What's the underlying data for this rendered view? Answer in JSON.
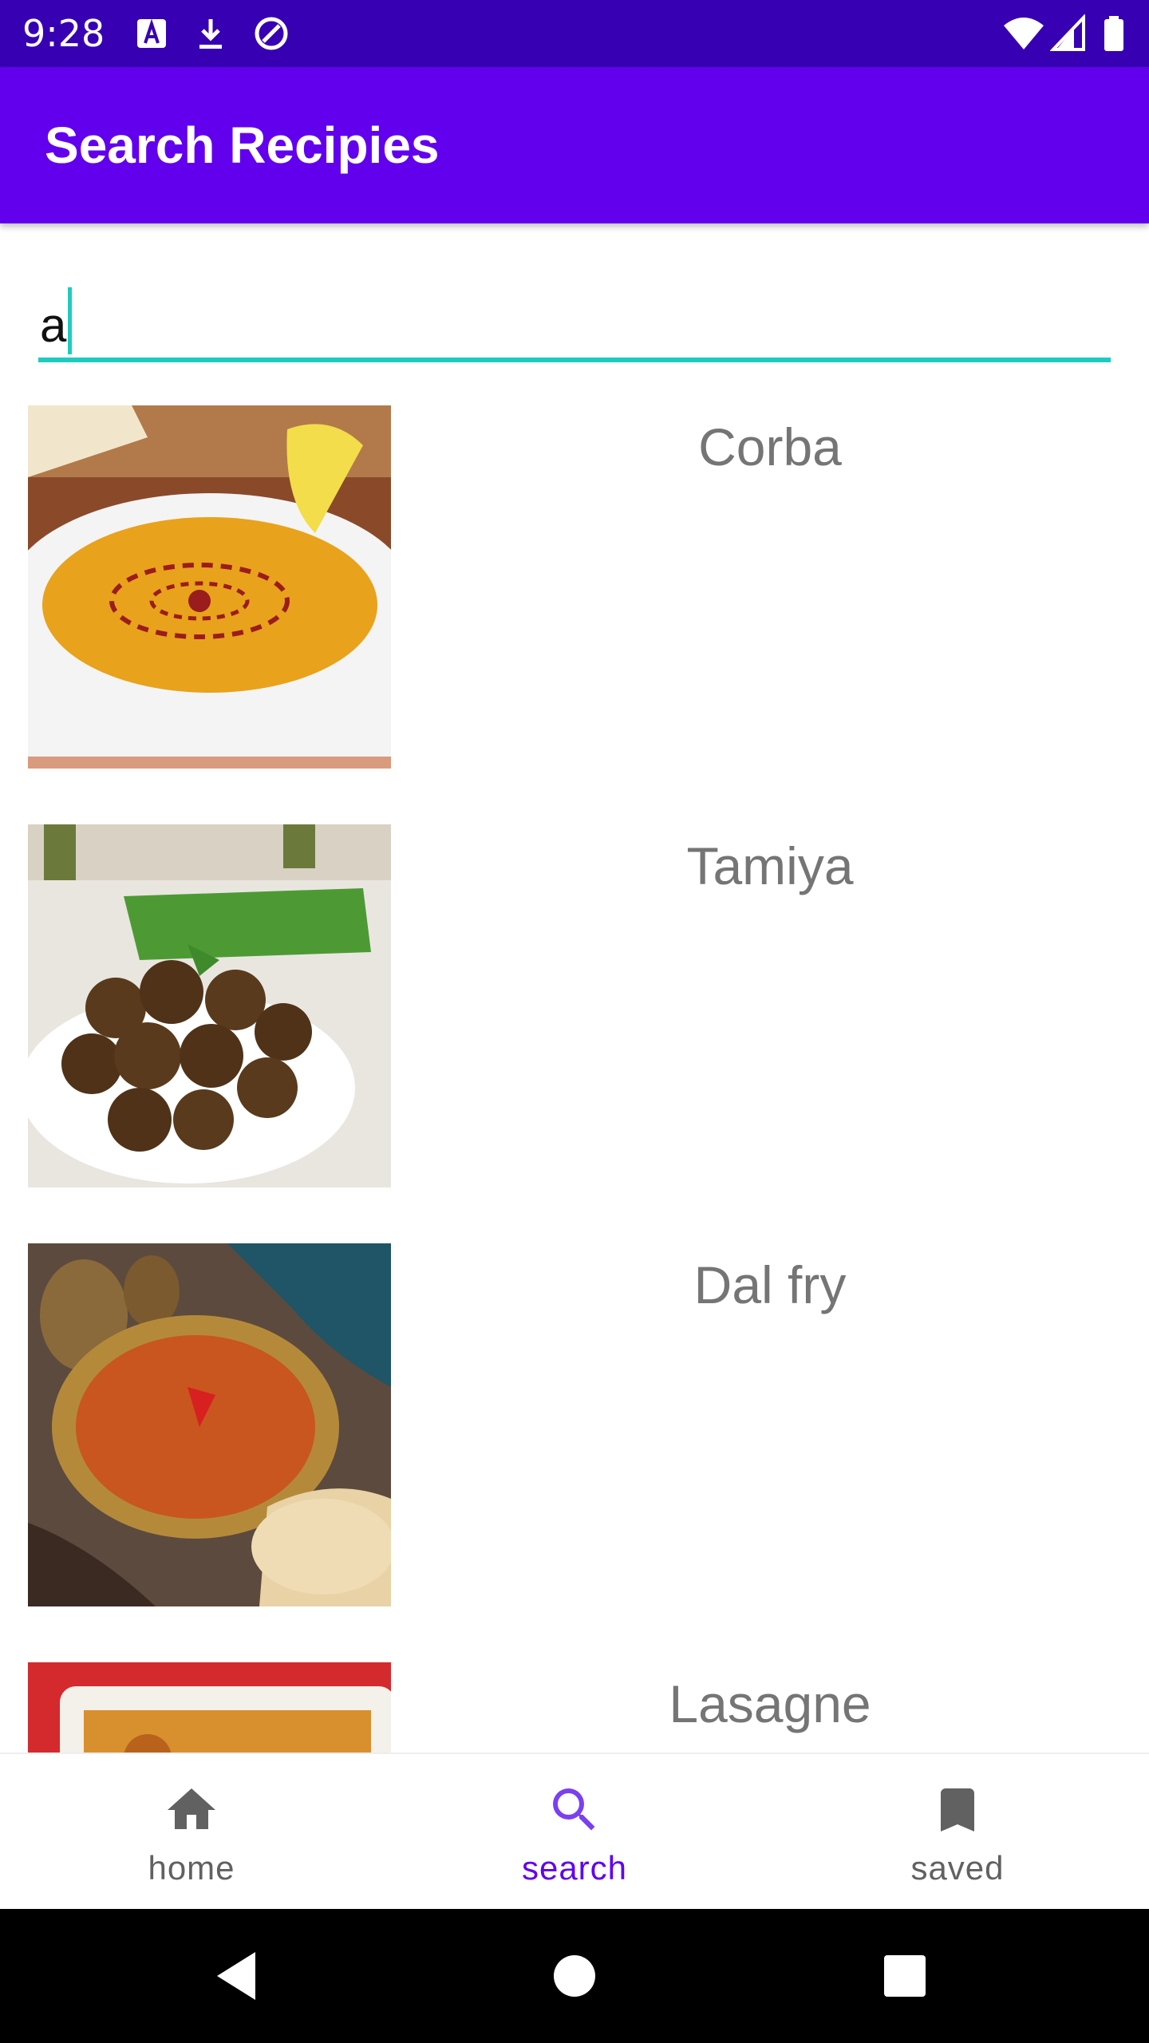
{
  "status_bar": {
    "time": "9:28",
    "icons": [
      "keyboard-a-icon",
      "download-icon",
      "at-sign-icon",
      "wifi-icon",
      "signal-icon",
      "battery-icon"
    ]
  },
  "app_bar": {
    "title": "Search Recipies"
  },
  "search": {
    "value": "a"
  },
  "results": [
    {
      "name": "Corba",
      "image": "lentil-soup-bowl"
    },
    {
      "name": "Tamiya",
      "image": "falafel-plate"
    },
    {
      "name": "Dal fry",
      "image": "dal-pot-with-naan"
    },
    {
      "name": "Lasagne",
      "image": "lasagne-dish"
    }
  ],
  "bottom_nav": {
    "items": [
      {
        "label": "home",
        "icon": "home-icon",
        "active": false
      },
      {
        "label": "search",
        "icon": "search-icon",
        "active": true
      },
      {
        "label": "saved",
        "icon": "bookmark-icon",
        "active": false
      }
    ]
  },
  "colors": {
    "status_bar": "#3700b3",
    "app_bar": "#6200ee",
    "accent": "#1ecbc0",
    "nav_active": "#6200ee",
    "nav_inactive": "#616161",
    "result_text": "#757575"
  }
}
